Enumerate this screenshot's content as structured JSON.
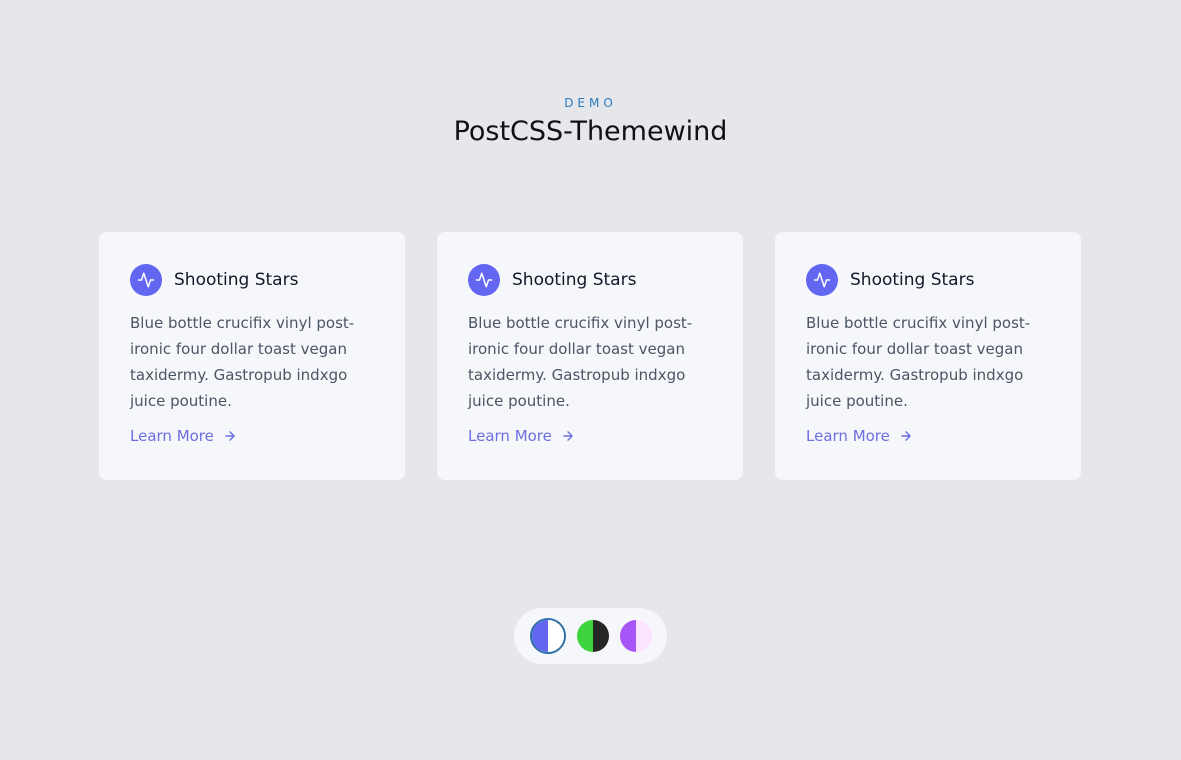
{
  "header": {
    "eyebrow": "DEMO",
    "title": "PostCSS-Themewind"
  },
  "cards": [
    {
      "title": "Shooting Stars",
      "text": "Blue bottle crucifix vinyl post-ironic four dollar toast vegan taxidermy. Gastropub indxgo juice poutine.",
      "link": "Learn More",
      "icon": "activity-icon"
    },
    {
      "title": "Shooting Stars",
      "text": "Blue bottle crucifix vinyl post-ironic four dollar toast vegan taxidermy. Gastropub indxgo juice poutine.",
      "link": "Learn More",
      "icon": "activity-icon"
    },
    {
      "title": "Shooting Stars",
      "text": "Blue bottle crucifix vinyl post-ironic four dollar toast vegan taxidermy. Gastropub indxgo juice poutine.",
      "link": "Learn More",
      "icon": "activity-icon"
    }
  ],
  "theme_switcher": {
    "options": [
      {
        "name": "indigo-light",
        "left": "#6366f1",
        "right": "#ffffff",
        "selected": true
      },
      {
        "name": "green-dark",
        "left": "#3ed43e",
        "right": "#262626",
        "selected": false
      },
      {
        "name": "purple-pink",
        "left": "#a855f7",
        "right": "#fbe4ff",
        "selected": false
      }
    ]
  },
  "colors": {
    "background": "#e5e7eb",
    "card": "#f6f7fb",
    "accent": "#6366f1",
    "eyebrow": "#2b7bbd"
  }
}
